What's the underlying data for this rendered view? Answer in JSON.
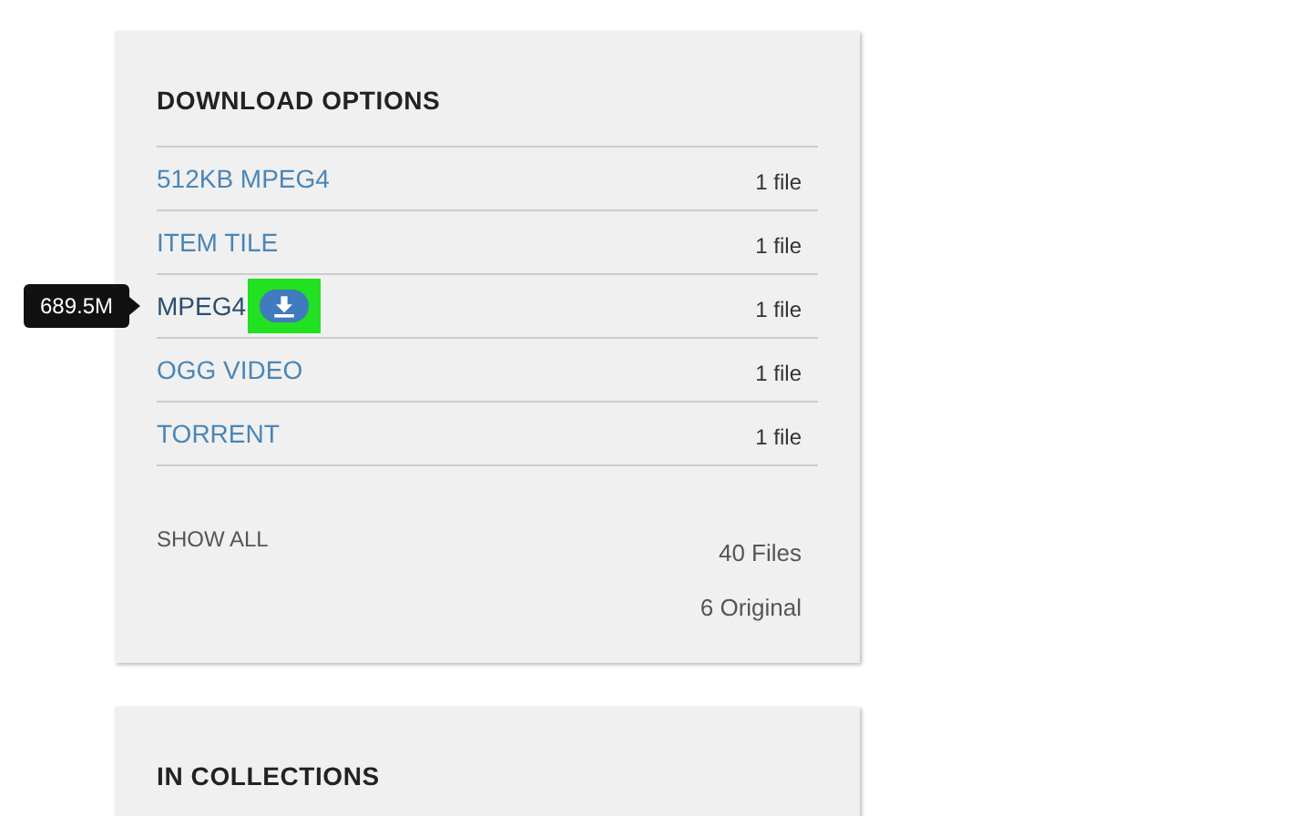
{
  "download_options": {
    "title": "DOWNLOAD OPTIONS",
    "items": [
      {
        "label": "512KB MPEG4",
        "count": "1 file",
        "hovered": false
      },
      {
        "label": "ITEM TILE",
        "count": "1 file",
        "hovered": false
      },
      {
        "label": "MPEG4",
        "count": "1 file",
        "hovered": true,
        "tooltip": "689.5M"
      },
      {
        "label": "OGG VIDEO",
        "count": "1 file",
        "hovered": false
      },
      {
        "label": "TORRENT",
        "count": "1 file",
        "hovered": false
      }
    ],
    "show_all": "SHOW ALL",
    "total_files": "40 Files",
    "original_files": "6 Original"
  },
  "collections": {
    "title": "IN COLLECTIONS"
  }
}
